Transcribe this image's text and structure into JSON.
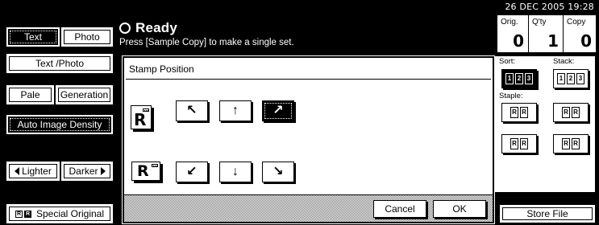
{
  "left_panel": {
    "text_label": "Text",
    "photo_label": "Photo",
    "text_photo_label": "Text /Photo",
    "pale_label": "Pale",
    "generation_label": "Generation",
    "auto_density_label": "Auto Image Density",
    "lighter_label": "Lighter",
    "darker_label": "Darker",
    "special_original_label": "Special Original"
  },
  "header": {
    "status": "Ready",
    "message": "Press [Sample Copy] to make a single set."
  },
  "main": {
    "title": "Stamp Position",
    "stamp_letter": "R",
    "arrows": {
      "up_left": "↖",
      "up": "↑",
      "up_right": "↗",
      "down_left": "↙",
      "down": "↓",
      "down_right": "↘"
    },
    "selected_position": "up_right",
    "cancel_label": "Cancel",
    "ok_label": "OK"
  },
  "status_bar": {
    "datetime": "26 DEC   2005 19:28",
    "orig_label": "Orig.",
    "orig_value": "0",
    "qty_label": "Q'ty",
    "qty_value": "1",
    "copy_label": "Copy",
    "copy_value": "0"
  },
  "right_panel": {
    "sort_label": "Sort:",
    "stack_label": "Stack:",
    "staple_label": "Staple:",
    "store_file_label": "Store File"
  }
}
